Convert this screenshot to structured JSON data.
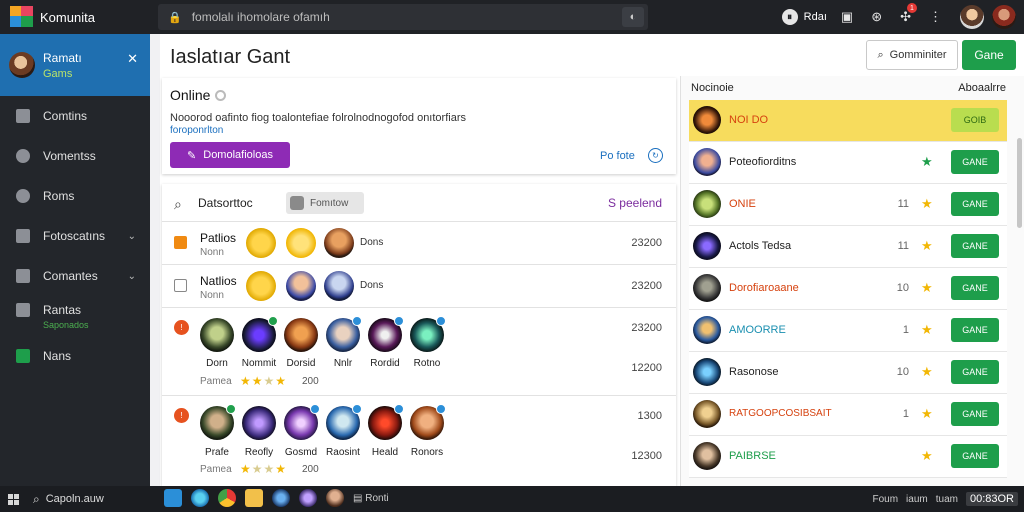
{
  "topbar": {
    "app_name": "Komunita",
    "search_text": "fomolalı ihomolare ofamıh",
    "profile_label": "Rdaı"
  },
  "sidebar": {
    "profile_name": "Ramatı",
    "profile_sub": "Gams",
    "items": [
      {
        "label": "Comtins"
      },
      {
        "label": "Vomentss"
      },
      {
        "label": "Roms"
      },
      {
        "label": "Fotoscatıns"
      },
      {
        "label": "Comantes"
      },
      {
        "label": "Rantas",
        "sub": "Saponados"
      },
      {
        "label": "Nans"
      }
    ]
  },
  "main": {
    "title": "Iaslatıar Gant",
    "btn_secondary": "Gomminiter",
    "btn_primary": "Gane"
  },
  "online": {
    "heading": "Online",
    "desc": "Nooorod oafinto fiog toalontefiae folrolnodnogofod onıtorfiars",
    "link": "foroponrlton",
    "purple_btn": "Domolafioloas",
    "link2": "Po fote"
  },
  "list": {
    "header": "Datsorttoc",
    "chip": "Fomıtow",
    "header_right": "S peelend",
    "rows": [
      {
        "name": "Patlios",
        "sub": "Nonn",
        "label": "Dons",
        "number": "23200"
      },
      {
        "name": "Natlios",
        "sub": "Nonn",
        "label": "Dons",
        "number": "23200"
      },
      {
        "captions": [
          "Dorn",
          "Nommit",
          "Dorsid",
          "Nnlr",
          "Rordid",
          "Rotno"
        ],
        "sub": "Pamea",
        "count": "200",
        "number": "23200",
        "number2": "12200"
      },
      {
        "captions": [
          "Prafe",
          "Reofly",
          "Gosmd",
          "Raosint",
          "Heald",
          "Ronors"
        ],
        "sub": "Pamea",
        "count": "200",
        "number": "1300",
        "number2": "12300"
      }
    ]
  },
  "rpanel": {
    "title": "Nocinoie",
    "more": "Aboaalrre",
    "items": [
      {
        "name": "NOI DO",
        "count": "",
        "btn": "GOIB",
        "name_color": "#d6420f"
      },
      {
        "name": "Poteofiorditns",
        "count": "",
        "btn": "GANE",
        "name_color": "#222222"
      },
      {
        "name": "ONIE",
        "count": "11",
        "btn": "GANE",
        "name_color": "#d6420f"
      },
      {
        "name": "Actols Tedsa",
        "count": "11",
        "btn": "GANE",
        "name_color": "#222222"
      },
      {
        "name": "Dorofiaroaane",
        "count": "10",
        "btn": "GANE",
        "name_color": "#d6420f"
      },
      {
        "name": "AMOORRE",
        "count": "1",
        "btn": "GANE",
        "name_color": "#1a8fb0"
      },
      {
        "name": "Rasonose",
        "count": "10",
        "btn": "GANE",
        "name_color": "#222222"
      },
      {
        "name": "RATGOOPCOSIBSAIT",
        "count": "1",
        "btn": "GANE",
        "name_color": "#d6420f"
      },
      {
        "name": "PAIBRSE",
        "count": "",
        "btn": "GANE",
        "name_color": "#1e9e4b"
      }
    ]
  },
  "taskbar": {
    "search": "Capoln.auw",
    "app_label": "Ronti",
    "tray1": "Foum",
    "tray2": "iaum",
    "tray3": "tuam",
    "clock": "00:83OR"
  },
  "colors": {
    "brand_blue": "#1f6fb0",
    "accent_green": "#1e9e4b",
    "accent_purple": "#8e2bb5",
    "highlight_yellow": "#f7dc5d",
    "star_gold": "#f2b705"
  }
}
